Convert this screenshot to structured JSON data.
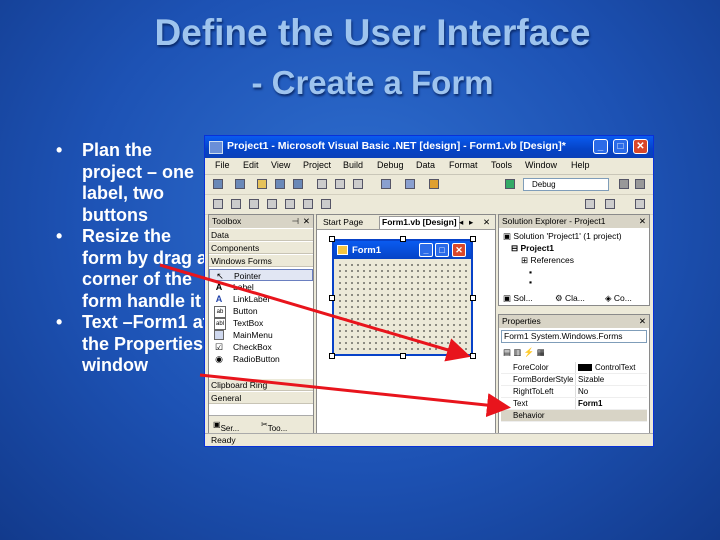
{
  "slide": {
    "title": "Define the User Interface",
    "subtitle": "- Create a Form",
    "bullets": [
      "Plan the project – one label, two buttons",
      "Resize the form by drag a corner of the form handle it",
      "Text –Form1 at the Properties window"
    ]
  },
  "window": {
    "title": "Project1 - Microsoft Visual Basic .NET [design] - Form1.vb [Design]*",
    "menu": [
      "File",
      "Edit",
      "View",
      "Project",
      "Build",
      "Debug",
      "Data",
      "Format",
      "Tools",
      "Window",
      "Help"
    ],
    "debug_config": "Debug",
    "status": "Ready"
  },
  "toolbox": {
    "title": "Toolbox",
    "sections": [
      "Data",
      "Components",
      "Windows Forms"
    ],
    "items": [
      {
        "icon": "pointer-icon",
        "label": "Pointer"
      },
      {
        "icon": "label-icon",
        "label": "Label"
      },
      {
        "icon": "linklabel-icon",
        "label": "LinkLabel"
      },
      {
        "icon": "button-icon",
        "label": "Button"
      },
      {
        "icon": "textbox-icon",
        "label": "TextBox"
      },
      {
        "icon": "mainmenu-icon",
        "label": "MainMenu"
      },
      {
        "icon": "checkbox-icon",
        "label": "CheckBox"
      },
      {
        "icon": "radiobutton-icon",
        "label": "RadioButton"
      }
    ],
    "clipboard": "Clipboard Ring",
    "general": "General",
    "bottom_tabs": [
      "Ser...",
      "Too..."
    ]
  },
  "designer": {
    "tabs": [
      "Start Page",
      "Form1.vb [Design]"
    ],
    "form_title": "Form1"
  },
  "solution_explorer": {
    "title": "Solution Explorer - Project1",
    "solution": "Solution 'Project1' (1 project)",
    "project": "Project1",
    "references": "References",
    "bottom_tabs": [
      "Sol...",
      "Cla...",
      "Co..."
    ]
  },
  "properties": {
    "title": "Properties",
    "object": "Form1  System.Windows.Forms",
    "rows": [
      {
        "name": "ForeColor",
        "value": "ControlText"
      },
      {
        "name": "FormBorderStyle",
        "value": "Sizable"
      },
      {
        "name": "RightToLeft",
        "value": "No"
      },
      {
        "name": "Text",
        "value": "Form1"
      },
      {
        "name": "Behavior",
        "value": ""
      }
    ]
  },
  "colors": {
    "accent": "#e8141c",
    "titlebar": "#0543c6",
    "slide_text": "#9ec4ee"
  }
}
